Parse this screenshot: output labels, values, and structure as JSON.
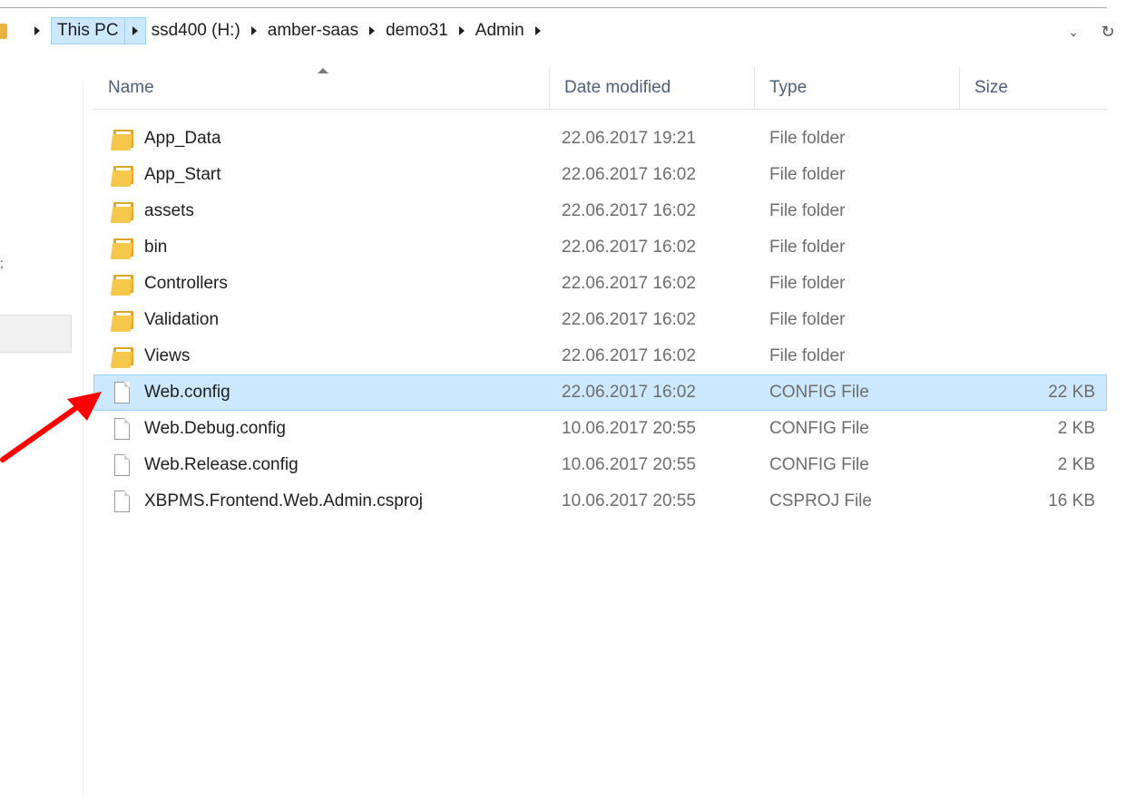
{
  "breadcrumb": {
    "this_pc": "This PC",
    "parts": [
      "ssd400 (H:)",
      "amber-saas",
      "demo31",
      "Admin"
    ]
  },
  "columns": {
    "name": "Name",
    "date_modified": "Date modified",
    "type": "Type",
    "size": "Size"
  },
  "files": [
    {
      "name": "App_Data",
      "date": "22.06.2017 19:21",
      "type": "File folder",
      "size": "",
      "kind": "folder"
    },
    {
      "name": "App_Start",
      "date": "22.06.2017 16:02",
      "type": "File folder",
      "size": "",
      "kind": "folder"
    },
    {
      "name": "assets",
      "date": "22.06.2017 16:02",
      "type": "File folder",
      "size": "",
      "kind": "folder"
    },
    {
      "name": "bin",
      "date": "22.06.2017 16:02",
      "type": "File folder",
      "size": "",
      "kind": "folder"
    },
    {
      "name": "Controllers",
      "date": "22.06.2017 16:02",
      "type": "File folder",
      "size": "",
      "kind": "folder"
    },
    {
      "name": "Validation",
      "date": "22.06.2017 16:02",
      "type": "File folder",
      "size": "",
      "kind": "folder"
    },
    {
      "name": "Views",
      "date": "22.06.2017 16:02",
      "type": "File folder",
      "size": "",
      "kind": "folder"
    },
    {
      "name": "Web.config",
      "date": "22.06.2017 16:02",
      "type": "CONFIG File",
      "size": "22 KB",
      "kind": "file"
    },
    {
      "name": "Web.Debug.config",
      "date": "10.06.2017 20:55",
      "type": "CONFIG File",
      "size": "2 KB",
      "kind": "file"
    },
    {
      "name": "Web.Release.config",
      "date": "10.06.2017 20:55",
      "type": "CONFIG File",
      "size": "2 KB",
      "kind": "file"
    },
    {
      "name": "XBPMS.Frontend.Web.Admin.csproj",
      "date": "10.06.2017 20:55",
      "type": "CSPROJ File",
      "size": "16 KB",
      "kind": "file"
    }
  ],
  "icons": {
    "dropdown": "chevron-down-icon",
    "refresh": "refresh-icon",
    "folder": "folder-icon",
    "file": "file-icon"
  },
  "colors": {
    "selection_bg": "#cce8ff",
    "selection_border": "#99d1ff",
    "header_text": "#4c607a",
    "annotation_arrow": "#ff0000"
  },
  "nav_fragment": ";"
}
